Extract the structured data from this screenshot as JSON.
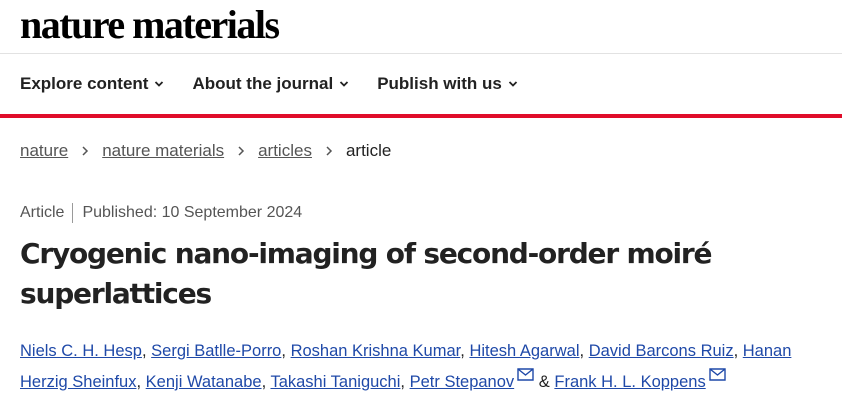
{
  "site": {
    "logo": "nature materials",
    "accent_color": "#e00d2a",
    "link_color": "#1f49a8"
  },
  "nav": [
    {
      "label": "Explore content",
      "icon": "chevron-down-icon"
    },
    {
      "label": "About the journal",
      "icon": "chevron-down-icon"
    },
    {
      "label": "Publish with us",
      "icon": "chevron-down-icon"
    }
  ],
  "breadcrumb": {
    "links": [
      "nature",
      "nature materials",
      "articles"
    ],
    "current": "article",
    "separator_icon": "chevron-right-icon"
  },
  "article": {
    "type": "Article",
    "published": "Published: 10 September 2024",
    "title": "Cryogenic nano-imaging of second-order moiré superlattices",
    "authors": [
      "Niels C. H. Hesp",
      "Sergi Batlle-Porro",
      "Roshan Krishna Kumar",
      "Hitesh Agarwal",
      "David Barcons Ruiz",
      "Hanan Herzig Sheinfux",
      "Kenji Watanabe",
      "Takashi Taniguchi",
      "Petr Stepanov",
      "Frank H. L. Koppens"
    ],
    "separator": ",",
    "conjunction": "&",
    "corresponding_icon": "mail-icon"
  }
}
